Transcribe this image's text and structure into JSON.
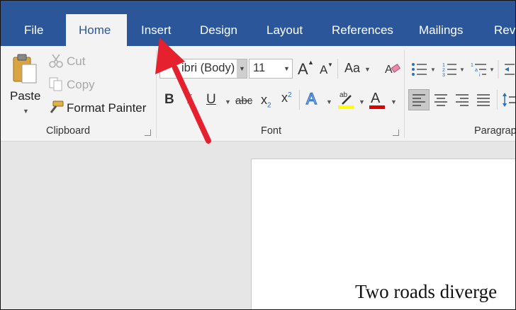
{
  "tabs": [
    {
      "label": "File"
    },
    {
      "label": "Home"
    },
    {
      "label": "Insert"
    },
    {
      "label": "Design"
    },
    {
      "label": "Layout"
    },
    {
      "label": "References"
    },
    {
      "label": "Mailings"
    },
    {
      "label": "Revi"
    }
  ],
  "clipboard": {
    "paste_label": "Paste",
    "cut_label": "Cut",
    "copy_label": "Copy",
    "format_painter_label": "Format Painter",
    "group_label": "Clipboard"
  },
  "font": {
    "name_value": "ibri (Body)",
    "size_value": "11",
    "case_label": "Aa",
    "strike_label": "abc",
    "group_label": "Font"
  },
  "paragraph": {
    "group_label": "Paragrap"
  },
  "document": {
    "text": "Two roads diverge"
  },
  "colors": {
    "tab_bar": "#2b579a",
    "ribbon": "#f3f3f3",
    "arrow": "#e5202f",
    "highlight": "#ffff00",
    "font_color": "#e00000"
  }
}
